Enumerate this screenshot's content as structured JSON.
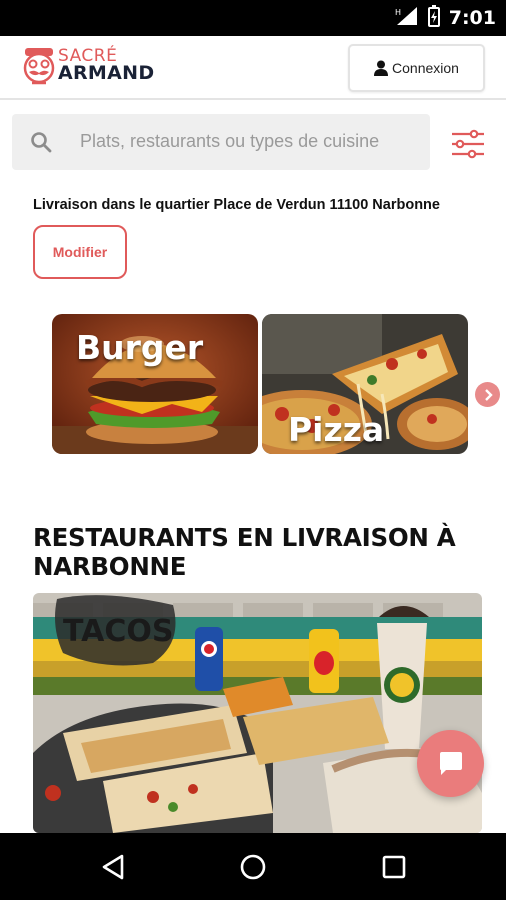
{
  "status_bar": {
    "time": "7:01"
  },
  "header": {
    "logo_line1": "SACRÉ",
    "logo_line2": "ARMAND",
    "login_label": "Connexion"
  },
  "search": {
    "placeholder": "Plats, restaurants ou types de cuisine"
  },
  "delivery": {
    "text": "Livraison dans le quartier Place de Verdun 11100 Narbonne",
    "modify_label": "Modifier"
  },
  "categories": [
    {
      "label": "Burger"
    },
    {
      "label": "Pizza"
    }
  ],
  "section": {
    "title": "RESTAURANTS EN LIVRAISON À NARBONNE"
  },
  "restaurant_image": {
    "sign_text": "TACOS"
  },
  "colors": {
    "accent": "#e05a5a",
    "chat_button": "#ea7c7c",
    "search_bg": "#efefef"
  },
  "icons": [
    "signal-icon",
    "battery-icon",
    "user-icon",
    "search-icon",
    "filter-icon",
    "chevron-right-icon",
    "chat-icon",
    "back-icon",
    "home-icon",
    "recents-icon"
  ]
}
